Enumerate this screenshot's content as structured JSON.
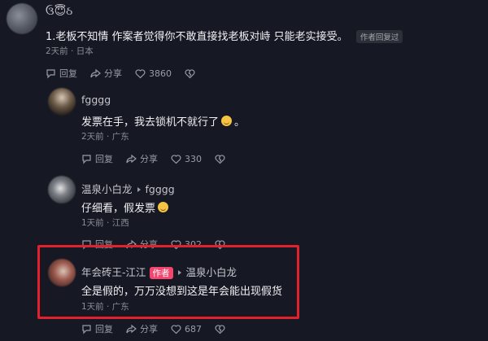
{
  "comments": [
    {
      "username": "ઉ😇ઠ",
      "content": "1.老板不知情 作案者觉得你不敢直接找老板对峙 只能老实接受。",
      "badge": "作者回复过",
      "meta": "2天前 · 日本",
      "actions": {
        "reply": "回复",
        "share": "分享",
        "likes": "3860"
      }
    },
    {
      "username": "fgggg",
      "content": "发票在手，我去锁机不就行了",
      "content_tail": "。",
      "meta": "2天前 · 广东",
      "actions": {
        "reply": "回复",
        "share": "分享",
        "likes": "330"
      }
    },
    {
      "username": "温泉小白龙",
      "reply_to": "fgggg",
      "content": "仔细看，假发票",
      "meta": "1天前 · 江西",
      "actions": {
        "reply": "回复",
        "share": "分享",
        "likes": "302"
      }
    },
    {
      "username": "年会砖王-江江",
      "author_badge": "作者",
      "reply_to": "温泉小白龙",
      "content": "全是假的，万万没想到这是年会能出现假货",
      "meta": "1天前 · 广东",
      "actions": {
        "reply": "回复",
        "share": "分享",
        "likes": "687"
      }
    }
  ],
  "colors": {
    "background": "#161823",
    "highlight": "#e3212c",
    "author_badge": "#f3466f"
  }
}
